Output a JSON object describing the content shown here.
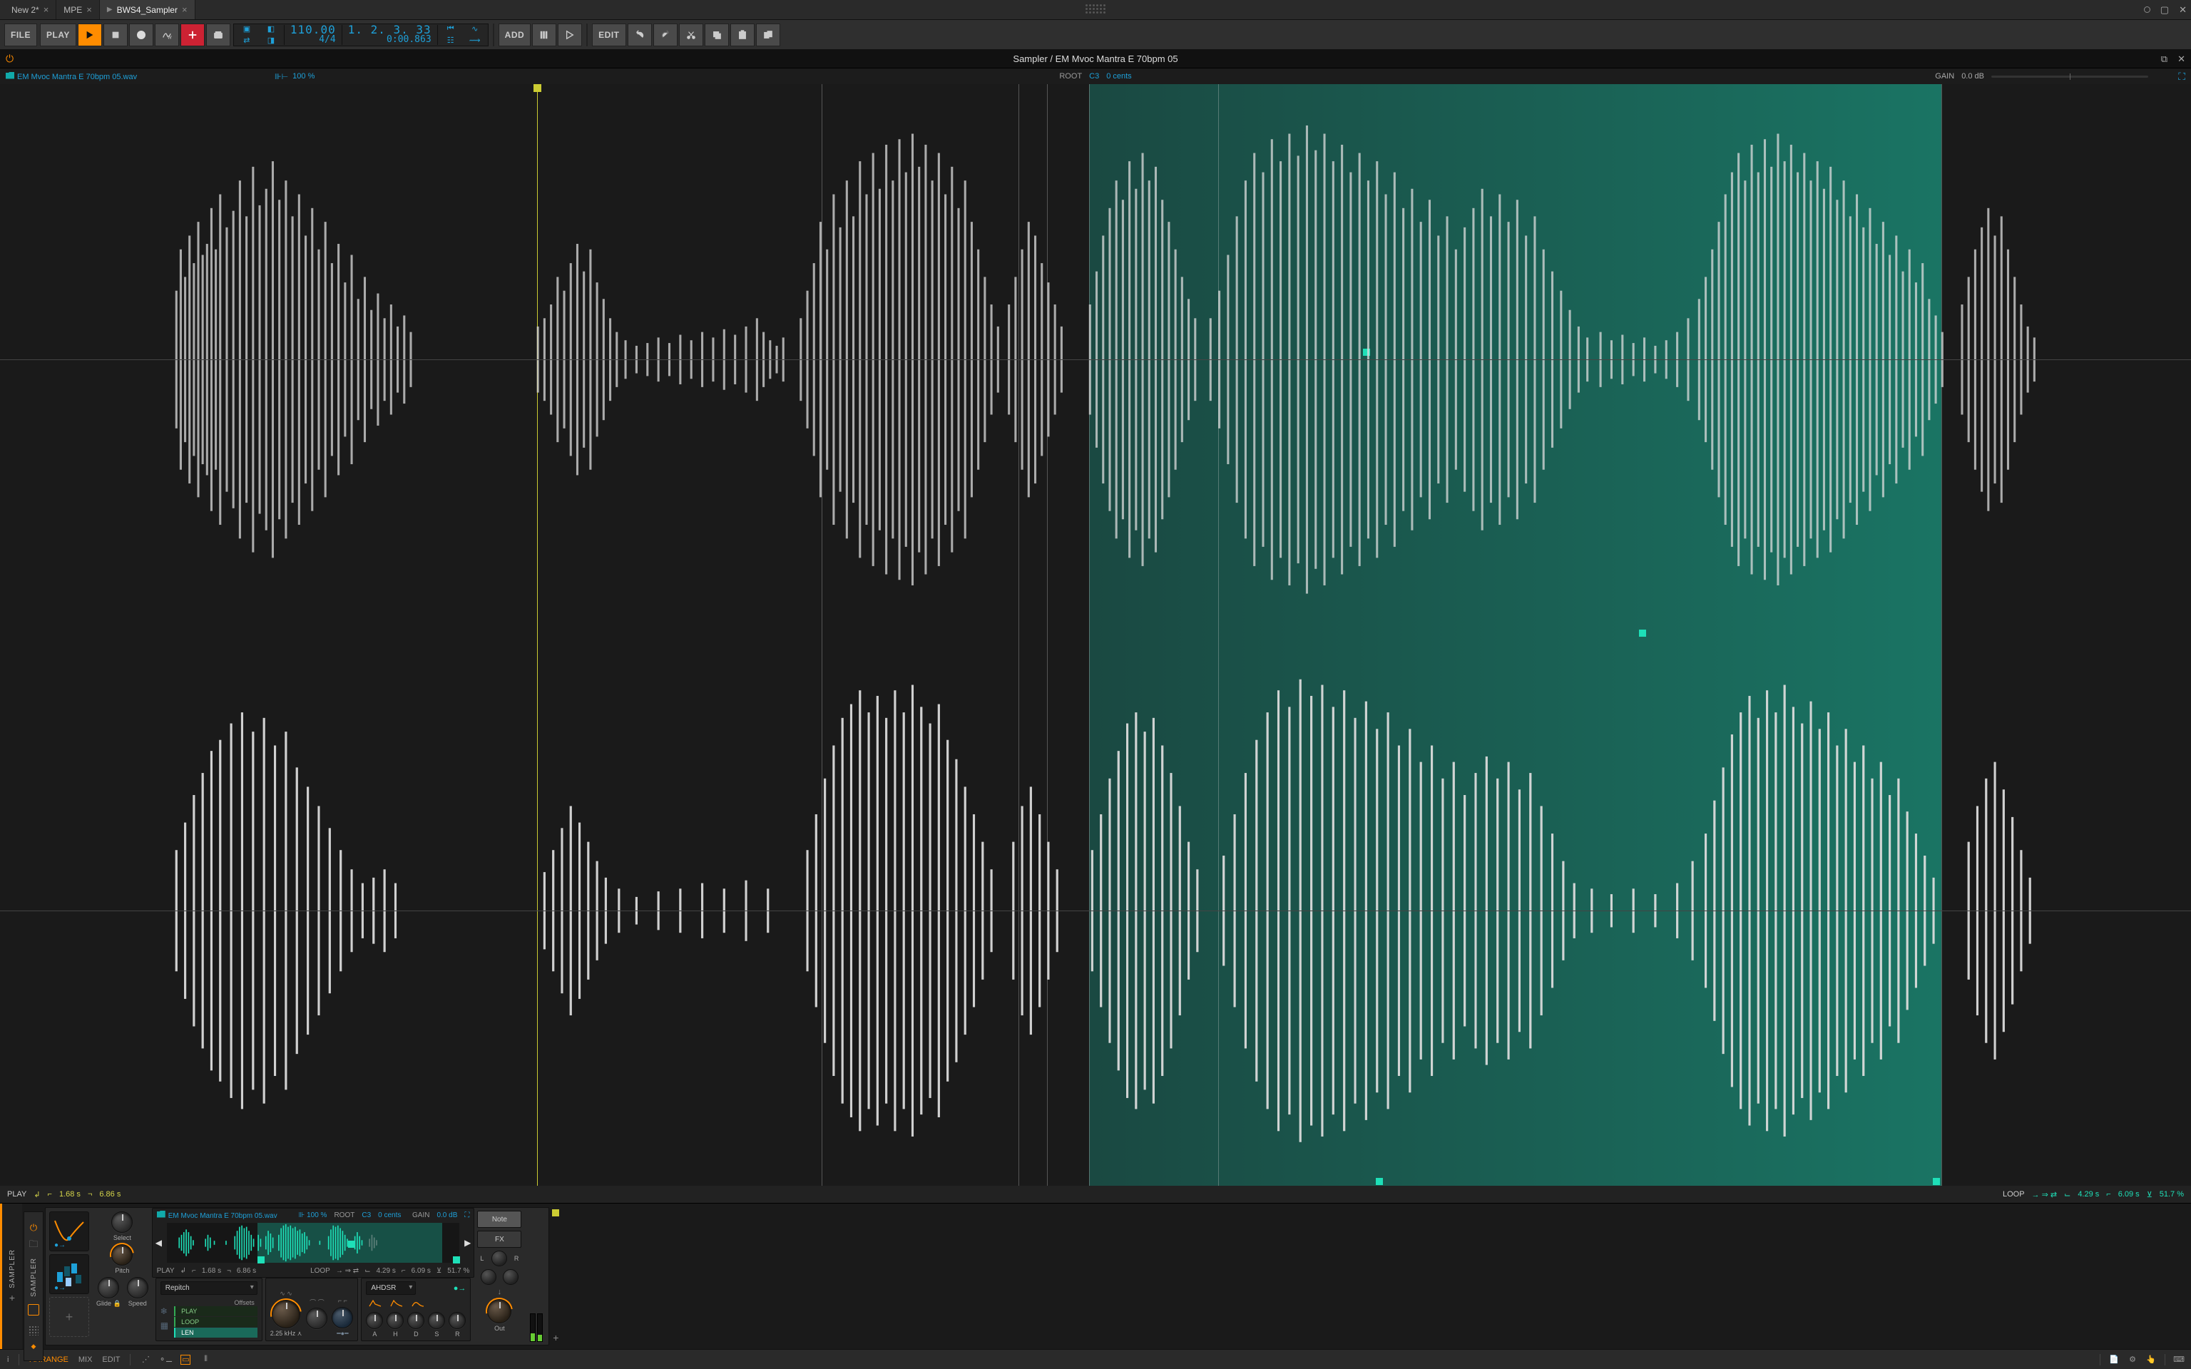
{
  "tabs": [
    {
      "label": "New 2*",
      "active": false,
      "playing": false
    },
    {
      "label": "MPE",
      "active": false,
      "playing": false
    },
    {
      "label": "BWS4_Sampler",
      "active": true,
      "playing": true
    }
  ],
  "toolbar": {
    "file": "FILE",
    "play": "PLAY",
    "add": "ADD",
    "edit": "EDIT"
  },
  "transport": {
    "tempo": "110.00",
    "timesig": "4/4",
    "position_bars": "1. 2. 3. 33",
    "position_time": "0:00.863"
  },
  "sampler_header": {
    "title": "Sampler / EM Mvoc Mantra E 70bpm 05"
  },
  "sample_info": {
    "filename": "EM Mvoc Mantra E 70bpm 05.wav",
    "zoom": "100 %",
    "root_label": "ROOT",
    "root_note": "C3",
    "root_cents": "0 cents",
    "gain_label": "GAIN",
    "gain_value": "0.0 dB"
  },
  "play_stats": {
    "play_label": "PLAY",
    "rev_sym": "↲",
    "start_marker": "⌐",
    "start": "1.68 s",
    "end_marker": "¬",
    "end": "6.86 s",
    "loop_label": "LOOP",
    "loop_mode": "→ ⇒ ⇄",
    "loop_start_marker": "⌙",
    "loop_start": "4.29 s",
    "loop_end_marker": "⌐",
    "loop_end": "6.09 s",
    "xfade_marker": "⊻",
    "xfade": "51.7 %"
  },
  "device": {
    "rail_label_outer": "SAMPLER",
    "rail_label_inner": "SAMPLER",
    "knobs": {
      "select": "Select",
      "pitch": "Pitch",
      "glide": "Glide",
      "speed": "Speed",
      "freq": "2.25 kHz",
      "freq_icon": "⋏",
      "out": "Out"
    },
    "playmode": {
      "dropdown": "Repitch",
      "offsets_label": "Offsets",
      "play": "PLAY",
      "loop": "LOOP",
      "len": "LEN"
    },
    "env": {
      "label": "AHDSR",
      "a": "A",
      "h": "H",
      "d": "D",
      "s": "S",
      "r": "R"
    },
    "mod": {
      "note": "Note",
      "fx": "FX",
      "l": "L",
      "r": "R"
    },
    "lock_sym": "🔒"
  },
  "bottombar": {
    "arrange": "ARRANGE",
    "mix": "MIX",
    "edit": "EDIT",
    "info": "i"
  }
}
